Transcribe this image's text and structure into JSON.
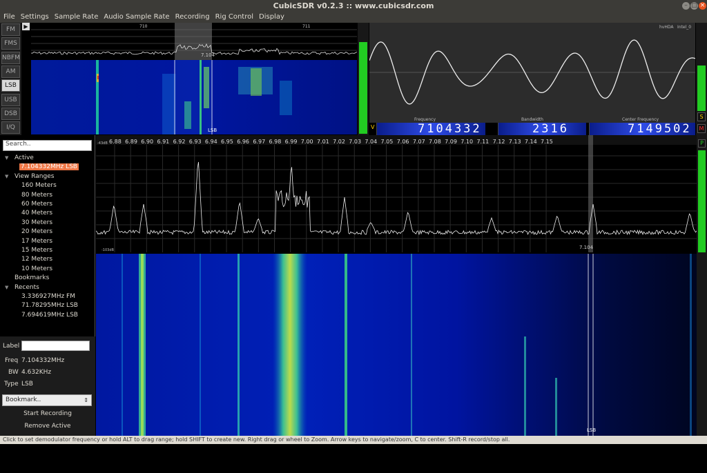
{
  "window": {
    "title": "CubicSDR v0.2.3 :: www.cubicsdr.com"
  },
  "menu": [
    "File",
    "Settings",
    "Sample Rate",
    "Audio Sample Rate",
    "Recording",
    "Rig Control",
    "Display"
  ],
  "modes": [
    {
      "label": "FM",
      "active": false
    },
    {
      "label": "FMS",
      "active": false
    },
    {
      "label": "NBFM",
      "active": false
    },
    {
      "label": "AM",
      "active": false
    },
    {
      "label": "LSB",
      "active": true
    },
    {
      "label": "USB",
      "active": false
    },
    {
      "label": "DSB",
      "active": false
    },
    {
      "label": "I/Q",
      "active": false
    }
  ],
  "mini_spectrum": {
    "ticks": [
      "710",
      "711"
    ],
    "marker": "7.104",
    "mode_label": "LSB"
  },
  "scope": {
    "labels": [
      "hvHDA",
      "Intel_0"
    ],
    "frequency_label": "Frequency",
    "bandwidth_label": "Bandwidth",
    "center_label": "Center Frequency"
  },
  "readouts": {
    "v_label": "V",
    "frequency": "7104332",
    "bandwidth": "2316",
    "center": "7149502"
  },
  "side_controls": [
    "S",
    "M",
    "P"
  ],
  "sidebar": {
    "search_placeholder": "Search..",
    "active_header": "Active",
    "active_item": "7.104332MHz LSB",
    "ranges_header": "View Ranges",
    "ranges": [
      "160 Meters",
      "80 Meters",
      "60 Meters",
      "40 Meters",
      "30 Meters",
      "20 Meters",
      "17 Meters",
      "15 Meters",
      "12 Meters",
      "10 Meters"
    ],
    "bookmarks_header": "Bookmarks",
    "recents_header": "Recents",
    "recents": [
      "3.336927MHz FM",
      "71.78295MHz LSB",
      "7.694619MHz LSB"
    ]
  },
  "info": {
    "label_label": "Label",
    "freq_label": "Freq",
    "freq_value": "7.104332MHz",
    "bw_label": "BW",
    "bw_value": "4.632KHz",
    "type_label": "Type",
    "type_value": "LSB",
    "bookmark_select": "Bookmark..",
    "start_recording": "Start Recording",
    "remove_active": "Remove Active"
  },
  "main_spectrum": {
    "ticks": [
      "6.88",
      "6.89",
      "6.90",
      "6.91",
      "6.92",
      "6.93",
      "6.94",
      "6.95",
      "6.96",
      "6.97",
      "6.98",
      "6.99",
      "7.00",
      "7.01",
      "7.02",
      "7.03",
      "7.04",
      "7.05",
      "7.06",
      "7.07",
      "7.08",
      "7.09",
      "7.10",
      "7.11",
      "7.12",
      "7.13",
      "7.14",
      "7.15"
    ],
    "top_db": "-43dB",
    "bottom_db": "-103dB",
    "marker": "7.104"
  },
  "main_waterfall": {
    "mode_label": "LSB"
  },
  "status": "Click to set demodulator frequency or hold ALT to drag range; hold SHIFT to create new.  Right drag or wheel to Zoom.  Arrow keys to navigate/zoom, C to center.  Shift-R record/stop all.",
  "colors": {
    "waterfall_bg": "#00106a",
    "meter_green": "#22cc22",
    "highlight": "#f07746"
  }
}
